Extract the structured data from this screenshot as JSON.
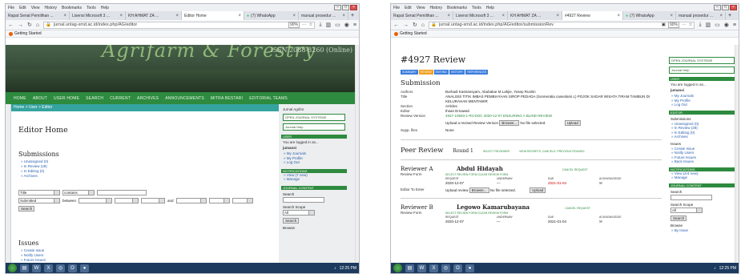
{
  "left": {
    "menubar": [
      "File",
      "Edit",
      "View",
      "History",
      "Bookmarks",
      "Tools",
      "Help"
    ],
    "tabs": [
      {
        "label": "Rapat Senat Pemilihan ..."
      },
      {
        "label": "Lisensi Microsoft 3 ..."
      },
      {
        "label": "KH AHMAT ZA ..."
      },
      {
        "label": "Editor Home",
        "active": true
      },
      {
        "label": "(7) WhatsApp"
      },
      {
        "label": "manual prosedur ..."
      }
    ],
    "url": "jurnal.untag-smd.ac.id/index.php/AG/editor",
    "zoom": "90%",
    "bookmark": "Getting Started",
    "banner": {
      "title": "Agrifarm & Forestry",
      "issn": "ISSN 2088-8260 (Online)"
    },
    "nav": [
      "HOME",
      "ABOUT",
      "USER HOME",
      "SEARCH",
      "CURRENT",
      "ARCHIVES",
      "ANNOUNCEMENTS",
      "MITRA BESTARI",
      "EDITORIAL TEAMS"
    ],
    "breadcrumb": "Home > User > Editor",
    "heading": "Editor Home",
    "submissions_title": "Submissions",
    "submissions": [
      "Unassigned (0)",
      "In Review (28)",
      "In Editing (0)",
      "Archives"
    ],
    "search": {
      "field": "Title",
      "op": "contains",
      "date_field": "Submitted",
      "between": "between",
      "and": "and",
      "button": "Search"
    },
    "issues_title": "Issues",
    "issues": [
      "Create Issue",
      "Notify Users",
      "Future Issues",
      "Back Issues"
    ],
    "side": {
      "journal_label": "Jurnal Agrifor",
      "ojs": "OPEN JOURNAL SYSTEMS",
      "help": "Journal Help",
      "user_head": "USER",
      "logged": "You are logged in as...",
      "user": "jumansi",
      "user_links": [
        "My Journals",
        "My Profile",
        "Log Out"
      ],
      "notif_head": "NOTIFICATIONS",
      "notif_links": [
        "View (7 new)",
        "Manage"
      ],
      "content_head": "JOURNAL CONTENT",
      "search_label": "Search",
      "scope_label": "Search Scope",
      "scope": "All",
      "search_btn": "Search",
      "browse": "Browse"
    }
  },
  "right": {
    "menubar": [
      "File",
      "Edit",
      "View",
      "History",
      "Bookmarks",
      "Tools",
      "Help"
    ],
    "tabs": [
      {
        "label": "Rapat Senat Pemilihan ..."
      },
      {
        "label": "Lisensi Microsoft 3 ..."
      },
      {
        "label": "KH AHMAT ZA ..."
      },
      {
        "label": "#4927 Review",
        "active": true
      },
      {
        "label": "(7) WhatsApp"
      },
      {
        "label": "manual prosedur ..."
      }
    ],
    "url": "jurnal.untag-smd.ac.id/index.php/AG/editor/submissionRev",
    "zoom": "90%",
    "bookmark": "Getting Started",
    "heading": "#4927 Review",
    "tabs_page": [
      "SUMMARY",
      "REVIEW",
      "EDITING",
      "HISTORY",
      "REFERENCES"
    ],
    "submission_title": "Submission",
    "fields": [
      {
        "k": "Authors",
        "v": "Burhadi Kastransyam, Abubakar M Lahjie, Yosep Ruslim"
      },
      {
        "k": "Title",
        "v": "ANALISIS TITIK IMBAS PEMBIAYAAN SIROP PEDADA (Sonneratia caseolaris L) POJOK SADAR WISATA TIRAM TAMBUN DI KELURAHAN MENTAWIR"
      },
      {
        "k": "Section",
        "v": "Articles"
      },
      {
        "k": "Editor",
        "v": "Ihsan Ernawati"
      },
      {
        "k": "Review Version",
        "v": "4927-10593-1-RV.DOC   2020-12-07   ENSURING A BLIND REVIEW"
      }
    ],
    "upload_label": "Upload a revised Review Version",
    "browse": "Browse...",
    "nofile": "No file selected.",
    "upload_btn": "Upload",
    "supp_label": "Supp. files",
    "supp_value": "None",
    "peer_title": "Peer Review",
    "round": "Round 1",
    "select_reviewer": "SELECT REVIEWER",
    "view_regrets": "VIEW REGRETS, CANCELS, PREVIOUS ROUNDS",
    "reviewers": [
      {
        "label": "Reviewer A",
        "name": "Abdul Hidayah",
        "cancel": "CANCEL REQUEST",
        "form": "SELECT REVIEW FORM   CLEAR REVIEW FORM",
        "request": "2020-12-07",
        "underway": "—",
        "due": "2021-01-04"
      },
      {
        "label": "Reviewer B",
        "name": "Legowo Kamarubayana",
        "cancel": "CANCEL REQUEST",
        "form": "SELECT REVIEW FORM   CLEAR REVIEW FORM",
        "request": "2020-12-07",
        "underway": "—",
        "due": "2021-01-04"
      }
    ],
    "review_form_label": "Review Form",
    "col_heads": [
      "REQUEST",
      "UNDERWAY",
      "DUE",
      "ACKNOWLEDGE"
    ],
    "editor_label": "Editor To Enter",
    "upload_review": "Upload review",
    "side": {
      "ojs": "OPEN JOURNAL SYSTEMS",
      "help": "Journal Help",
      "user_head": "USER",
      "logged": "You are logged in as...",
      "user": "jumansi",
      "user_links": [
        "My Journals",
        "My Profile",
        "Log Out"
      ],
      "editor_head": "EDITOR",
      "subs_label": "Submissions",
      "subs": [
        "Unassigned (0)",
        "In Review (28)",
        "In Editing (0)",
        "Archives"
      ],
      "issues_label": "Issues",
      "issues": [
        "Create Issue",
        "Notify Users",
        "Future Issues",
        "Back Issues"
      ],
      "notif_head": "NOTIFICATIONS",
      "notif": [
        "View (4/4 new)",
        "Manage"
      ],
      "content_head": "JOURNAL CONTENT",
      "search_label": "Search",
      "scope_label": "Search Scope",
      "scope": "All",
      "search_btn": "Search",
      "browse": "Browse",
      "by_issue": "By Issue"
    }
  },
  "taskbar_time": "12:25 PM"
}
